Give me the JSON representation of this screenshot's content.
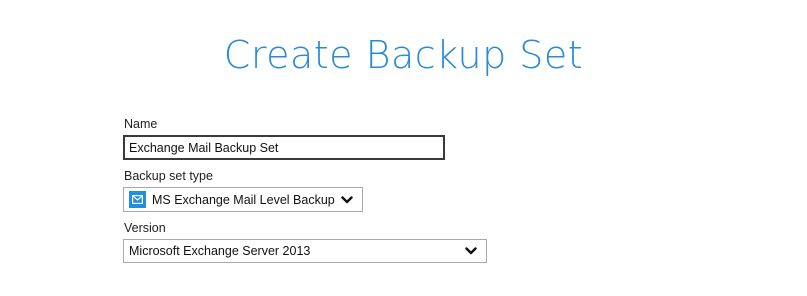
{
  "page": {
    "title": "Create Backup Set"
  },
  "form": {
    "name": {
      "label": "Name",
      "value": "Exchange Mail Backup Set"
    },
    "backup_set_type": {
      "label": "Backup set type",
      "selected": "MS Exchange Mail Level Backup",
      "icon": "mail-icon"
    },
    "version": {
      "label": "Version",
      "selected": "Microsoft Exchange Server 2013",
      "icon": "chevron-down-icon"
    }
  },
  "colors": {
    "title": "#2a8ad8",
    "icon_bg": "#1f8fde",
    "input_border": "#3a3a3a",
    "select_border": "#a9a9a9"
  }
}
